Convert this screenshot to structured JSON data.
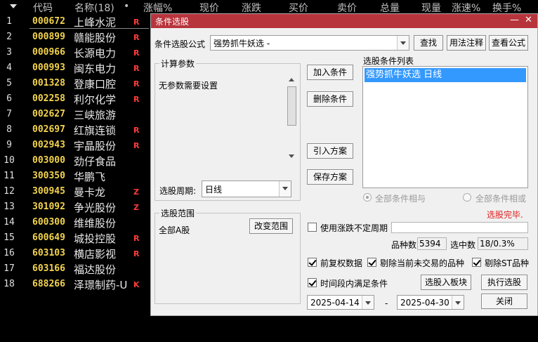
{
  "grid": {
    "columns": [
      "代码",
      "名称(18)",
      "涨幅%",
      "现价",
      "涨跌",
      "买价",
      "卖价",
      "总量",
      "现量",
      "涨速%",
      "换手%"
    ],
    "dot": "•",
    "rows": [
      {
        "idx": "1",
        "code": "000672",
        "name": "上峰水泥",
        "flag": "R"
      },
      {
        "idx": "2",
        "code": "000899",
        "name": "赣能股份",
        "flag": "R"
      },
      {
        "idx": "3",
        "code": "000966",
        "name": "长源电力",
        "flag": "R"
      },
      {
        "idx": "4",
        "code": "000993",
        "name": "闽东电力",
        "flag": "R"
      },
      {
        "idx": "5",
        "code": "001328",
        "name": "登康口腔",
        "flag": "R"
      },
      {
        "idx": "6",
        "code": "002258",
        "name": "利尔化学",
        "flag": "R"
      },
      {
        "idx": "7",
        "code": "002627",
        "name": "三峡旅游",
        "flag": ""
      },
      {
        "idx": "8",
        "code": "002697",
        "name": "红旗连锁",
        "flag": "R"
      },
      {
        "idx": "9",
        "code": "002943",
        "name": "宇晶股份",
        "flag": "R"
      },
      {
        "idx": "10",
        "code": "003000",
        "name": "劲仔食品",
        "flag": ""
      },
      {
        "idx": "11",
        "code": "300350",
        "name": "华鹏飞",
        "flag": ""
      },
      {
        "idx": "12",
        "code": "300945",
        "name": "曼卡龙",
        "flag": "Z"
      },
      {
        "idx": "13",
        "code": "301092",
        "name": "争光股份",
        "flag": "Z"
      },
      {
        "idx": "14",
        "code": "600300",
        "name": "维维股份",
        "flag": ""
      },
      {
        "idx": "15",
        "code": "600649",
        "name": "城投控股",
        "flag": "R"
      },
      {
        "idx": "16",
        "code": "603103",
        "name": "横店影视",
        "flag": "R"
      },
      {
        "idx": "17",
        "code": "603166",
        "name": "福达股份",
        "flag": ""
      },
      {
        "idx": "18",
        "code": "688266",
        "name": "泽璟制药-U",
        "flag": "K"
      }
    ]
  },
  "dialog": {
    "title": "条件选股",
    "minimize": "—",
    "close": "✕",
    "formula_label": "条件选股公式",
    "formula_value": "强势抓牛妖选 -",
    "find_btn": "查找",
    "usage_btn": "用法注释",
    "view_btn": "查看公式",
    "params_title": "计算参数",
    "params_text": "无参数需要设置",
    "period_label": "选股周期:",
    "period_value": "日线",
    "add_btn": "加入条件",
    "del_btn": "删除条件",
    "import_btn": "引入方案",
    "save_btn": "保存方案",
    "list_title": "选股条件列表",
    "list_items": [
      "强势抓牛妖选  日线"
    ],
    "radio_and": "全部条件相与",
    "radio_or": "全部条件相或",
    "status": "选股完毕.",
    "range_title": "选股范围",
    "range_text": "全部A股",
    "change_range_btn": "改变范围",
    "uncertain_label": "使用涨跌不定周期",
    "count_label": "品种数",
    "count_value": "5394",
    "selected_label": "选中数",
    "selected_value": "18/0.3%",
    "fuquan_label": "前复权数据",
    "exclude_label": "剔除当前未交易的品种",
    "exclude_st_label": "剔除ST品种",
    "timerange_label": "时间段内满足条件",
    "to_block_btn": "选股入板块",
    "run_btn": "执行选股",
    "date_from": "2025-04-14",
    "date_sep": "-",
    "date_to": "2025-04-30",
    "close_btn": "关闭"
  }
}
